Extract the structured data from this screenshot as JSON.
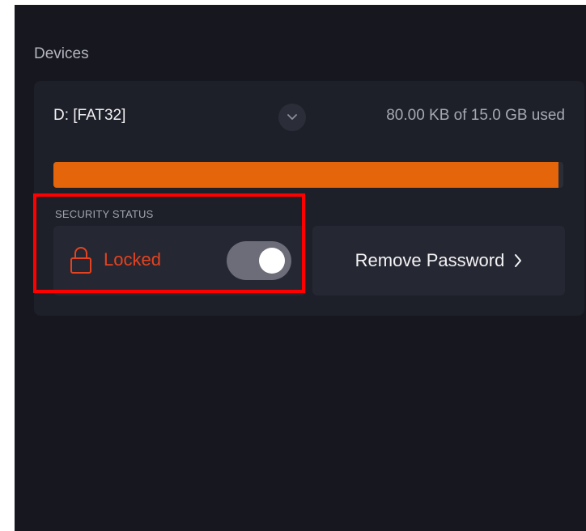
{
  "devices": {
    "section_title": "Devices",
    "drive": {
      "name": "D: [FAT32]",
      "usage_text": "80.00 KB of 15.0 GB used",
      "usage_fraction_shown": 0.99,
      "expand_icon": "chevron-down-icon"
    },
    "security": {
      "label": "SECURITY STATUS",
      "status_text": "Locked",
      "status_icon": "lock-icon",
      "toggle_on": true
    },
    "remove_password": {
      "label": "Remove Password",
      "icon": "chevron-right-icon"
    }
  },
  "colors": {
    "background": "#16171f",
    "card": "#1e2029",
    "accent_orange": "#e4650a",
    "locked_red": "#e5431f",
    "highlight_red": "#ff0000"
  }
}
